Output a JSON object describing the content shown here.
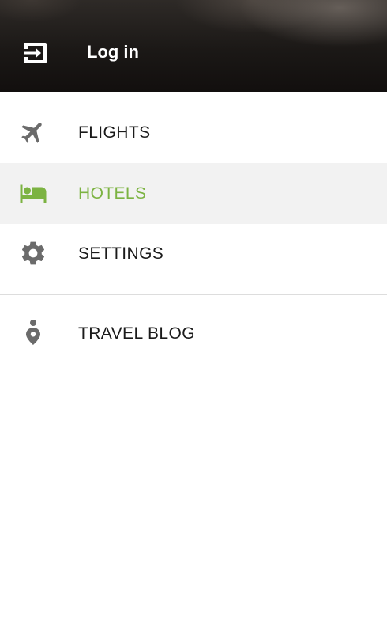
{
  "header": {
    "login_label": "Log in",
    "login_icon": "exit-to-app-icon"
  },
  "menu": {
    "items": [
      {
        "label": "FLIGHTS",
        "icon": "airplane-icon",
        "active": false
      },
      {
        "label": "HOTELS",
        "icon": "hotel-bed-icon",
        "active": true
      },
      {
        "label": "SETTINGS",
        "icon": "gear-icon",
        "active": false
      }
    ],
    "secondary": [
      {
        "label": "TRAVEL BLOG",
        "icon": "location-pin-icon",
        "active": false
      }
    ]
  },
  "colors": {
    "accent": "#7cb342",
    "icon_gray": "#6b6b6b",
    "active_background": "#f2f2f2",
    "text": "#1a1a1a",
    "divider": "#dddddd"
  }
}
